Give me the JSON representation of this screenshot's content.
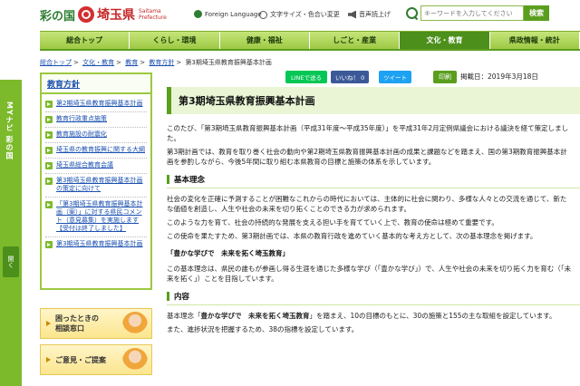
{
  "header": {
    "logo_irodori": "彩の国",
    "logo_saitama": "埼玉県",
    "logo_en_line1": "Saitama",
    "logo_en_line2": "Prefecture",
    "util_foreign": "Foreign Language",
    "util_textsize": "文字サイズ・色合い変更",
    "util_speech": "音声読上げ",
    "search_placeholder": "キーワードを入力してください",
    "search_button": "検索"
  },
  "nav": [
    {
      "label": "総合トップ"
    },
    {
      "label": "くらし・環境"
    },
    {
      "label": "健康・福祉"
    },
    {
      "label": "しごと・産業"
    },
    {
      "label": "文化・教育"
    },
    {
      "label": "県政情報・統計"
    }
  ],
  "breadcrumb": {
    "items": [
      "総合トップ",
      "文化・教育",
      "教育",
      "教育方針"
    ],
    "sep": ">",
    "current": "第3期埼玉県教育振興基本計画"
  },
  "mynavi": {
    "label": "MYナビ 彩の国",
    "open": "開く"
  },
  "sidebar": {
    "title": "教育方針",
    "items": [
      "第2期埼玉県教育振興基本計画",
      "教育行政重点施策",
      "教育施設の耐震化",
      "埼玉県の教育振興に関する大綱",
      "埼玉県総合教育会議",
      "第3期埼玉県教育振興基本計画の策定に向けて",
      "「第3期埼玉県教育振興基本計画（案）」に対する県民コメント（意見募集）を実施します【受付は終了しました】",
      "第3期埼玉県教育振興基本計画"
    ]
  },
  "banners": [
    {
      "line1": "困ったときの",
      "line2": "相談窓口"
    },
    {
      "line1": "ご意見・ご提案",
      "line2": ""
    }
  ],
  "share": {
    "line": "LINEで送る",
    "facebook": "いいね！ 0",
    "twitter": "ツイート",
    "print": "印刷",
    "date": "掲載日：2019年3月18日"
  },
  "main": {
    "title": "第3期埼玉県教育振興基本計画",
    "p1": "このたび、「第3期埼玉県教育振興基本計画（平成31年度～平成35年度）」を平成31年2月定例県議会における議決を経て策定しました。",
    "p2": "第3期計画では、教育を取り巻く社会の動向や第2期埼玉県教育振興基本計画の成果と課題などを踏まえ、国の第3期教育振興基本計画を参酌しながら、今後5年間に取り組む本県教育の目標と施策の体系を示しています。",
    "h_basic": "基本理念",
    "p3": "社会の変化を正確に予測することが困難なこれからの時代においては、主体的に社会に関わり、多様な人々との交流を通じて、新たな価値を創造し、人生や社会の未来を切り拓くことのできる力が求められます。",
    "p4": "このような力を育て、社会の持続的な発展を支える担い手を育てていく上で、教育の使命は極めて重要です。",
    "p5": "この使命を果たすため、第3期計画では、本県の教育行政を進めていく基本的な考え方として、次の基本理念を掲げます。",
    "h_ideal": "「豊かな学びで　未来を拓く埼玉教育」",
    "p6": "この基本理念は、県民の誰もが参画し得る生涯を通じた多様な学び（「豊かな学び」）で、人生や社会の未来を切り拓く力を育む（「未来を拓く」）ことを目指しています。",
    "h_content": "内容",
    "p7_pre": "基本理念「",
    "p7_strong": "豊かな学びで　未来を拓く埼玉教育",
    "p7_post": "」を踏まえ、10の目標のもとに、30の施策と155の主な取組を設定しています。",
    "p8": "また、進捗状況を把握するため、38の指標を設定しています。"
  }
}
